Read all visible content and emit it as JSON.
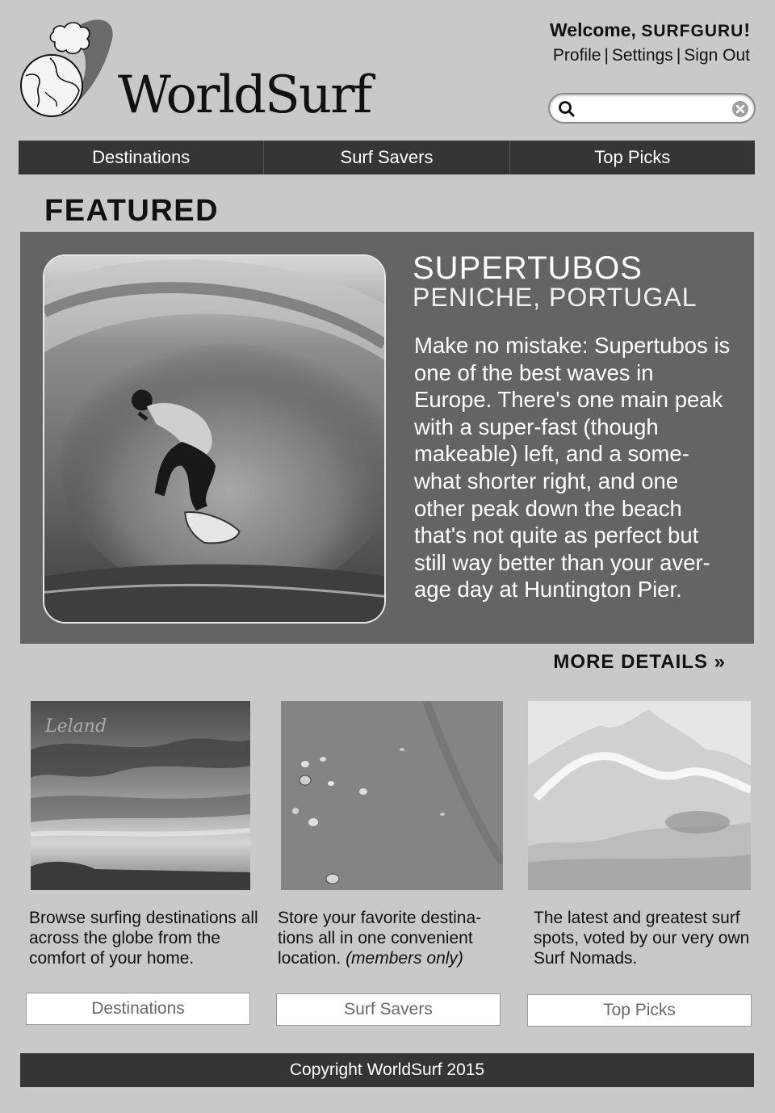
{
  "brand": {
    "name": "WorldSurf",
    "logo_icon": "globe-with-cloud-icon"
  },
  "account": {
    "welcome_prefix": "Welcome, ",
    "username": "SURFGURU",
    "welcome_suffix": "!",
    "links": [
      "Profile",
      "Settings",
      "Sign Out"
    ],
    "separator": "|"
  },
  "search": {
    "placeholder": "",
    "value": "",
    "icon": "search-icon",
    "clear_icon": "clear-icon"
  },
  "nav": {
    "items": [
      "Destinations",
      "Surf Savers",
      "Top Picks"
    ]
  },
  "featured": {
    "heading": "FEATURED",
    "title": "SUPERTUBOS",
    "subtitle": "PENICHE, PORTUGAL",
    "description": "Make no mistake: Supertubos is one of the best waves in Europe. There's one main peak with a super-fast (though makeable) left, and a some-what shorter right, and one other peak down the beach that's not quite as perfect but still way better than your aver-age day at Huntington Pier.",
    "more_link": "MORE DETAILS »"
  },
  "cards": [
    {
      "image_watermark": "Leland",
      "text": "Browse surfing destinations all across the globe from the comfort of your home.",
      "button": "Destinations"
    },
    {
      "text_main": "Store your favorite destina-tions all in one convenient location. ",
      "text_emphasis": "(members only)",
      "button": "Surf Savers"
    },
    {
      "text": "The latest and greatest surf spots, voted by our very own Surf Nomads.",
      "button": "Top Picks"
    }
  ],
  "footer": {
    "copyright": "Copyright WorldSurf 2015"
  },
  "colors": {
    "background": "#c9c9c9",
    "nav_bar": "#353535",
    "featured_panel": "#646464",
    "button_text": "#6a6a6a"
  }
}
